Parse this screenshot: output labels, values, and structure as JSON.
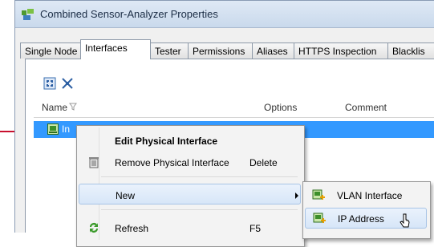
{
  "window": {
    "title": "Combined Sensor-Analyzer Properties"
  },
  "tabs": [
    {
      "label": "Single Node",
      "active": false
    },
    {
      "label": "Interfaces",
      "active": true
    },
    {
      "label": "Tester",
      "active": false
    },
    {
      "label": "Permissions",
      "active": false
    },
    {
      "label": "Aliases",
      "active": false
    },
    {
      "label": "HTTPS Inspection",
      "active": false
    },
    {
      "label": "Blacklis",
      "active": false
    }
  ],
  "toolbar": {
    "icons": [
      "expand-all-icon",
      "collapse-all-icon"
    ]
  },
  "table": {
    "columns": [
      "Name",
      "Options",
      "Comment"
    ],
    "selected_row_text": "In"
  },
  "context_menu": {
    "items": [
      {
        "label": "Edit Physical Interface",
        "shortcut": "",
        "bold": true,
        "icon": ""
      },
      {
        "label": "Remove Physical Interface",
        "shortcut": "Delete",
        "icon": "delete-icon"
      },
      {
        "label": "New",
        "shortcut": "",
        "submenu": true,
        "icon": ""
      },
      {
        "label": "Refresh",
        "shortcut": "F5",
        "icon": "refresh-icon"
      }
    ]
  },
  "submenu": {
    "items": [
      {
        "label": "VLAN Interface",
        "icon": "vlan-interface-icon"
      },
      {
        "label": "IP Address",
        "icon": "ip-address-icon"
      }
    ]
  },
  "colors": {
    "selection": "#3399ff",
    "callout": "#c8102e",
    "menu_hover": "#d7e6f8"
  }
}
